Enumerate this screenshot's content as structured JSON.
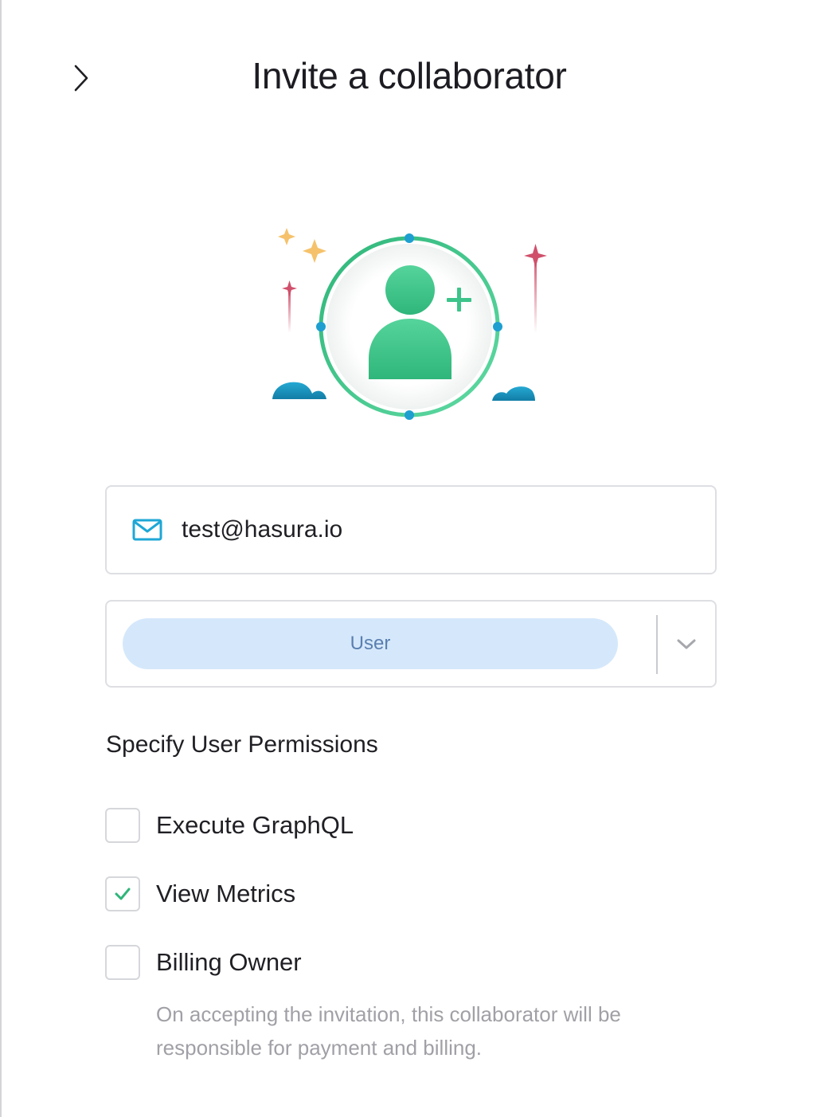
{
  "header": {
    "title": "Invite a collaborator",
    "collapse_icon": "chevron-right-icon"
  },
  "illustration": {
    "icon": "add-user-illustration",
    "colors": {
      "ring": "#3cc48a",
      "person": "#3cc48a",
      "dots": "#1e9fd0",
      "sparkle_gold": "#f5c26b",
      "sparkle_red": "#d0506b",
      "cloud": "#1b8fb8"
    }
  },
  "email": {
    "icon": "mail-icon",
    "value": "test@hasura.io",
    "placeholder": ""
  },
  "role": {
    "selected": "User",
    "dropdown_icon": "chevron-down-icon"
  },
  "permissions": {
    "heading": "Specify User Permissions",
    "items": [
      {
        "label": "Execute GraphQL",
        "checked": false
      },
      {
        "label": "View Metrics",
        "checked": true
      },
      {
        "label": "Billing Owner",
        "checked": false
      }
    ],
    "billing_note": "On accepting the invitation, this collaborator will be responsible for payment and billing."
  },
  "colors": {
    "accent_green": "#3cc48a",
    "check_green": "#2fb67a",
    "pill_bg": "#d5e8fb",
    "pill_text": "#5a7fb0",
    "mail_icon": "#1ea7d6",
    "muted_text": "#a0a0a6",
    "border": "#dedfe3"
  }
}
